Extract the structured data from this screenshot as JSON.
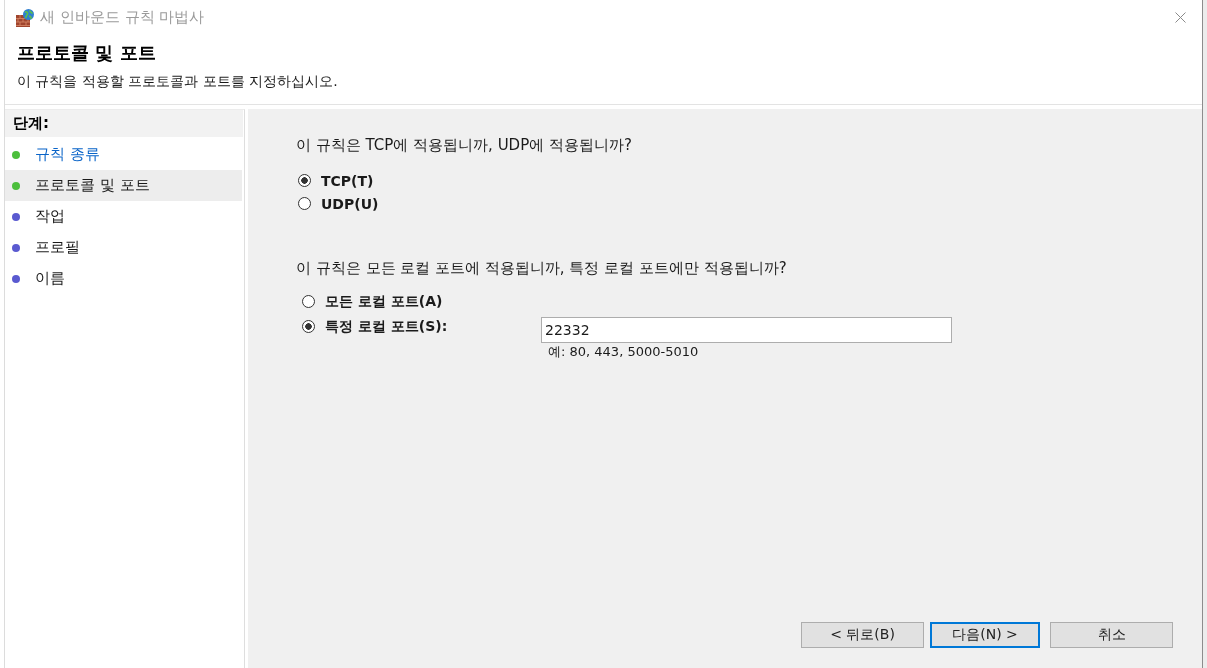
{
  "window": {
    "title": "새 인바운드 규칙 마법사"
  },
  "header": {
    "title": "프로토콜 및 포트",
    "description": "이 규칙을 적용할 프로토콜과 포트를 지정하십시오."
  },
  "steps": {
    "heading": "단계:",
    "items": [
      {
        "label": "규칙 종류",
        "selected": false,
        "link": true,
        "color": "#4cbf3c"
      },
      {
        "label": "프로토콜 및 포트",
        "selected": true,
        "link": false,
        "color": "#4cbf3c"
      },
      {
        "label": "작업",
        "selected": false,
        "link": false,
        "color": "#5a5ad0"
      },
      {
        "label": "프로필",
        "selected": false,
        "link": false,
        "color": "#5a5ad0"
      },
      {
        "label": "이름",
        "selected": false,
        "link": false,
        "color": "#5a5ad0"
      }
    ]
  },
  "protocol": {
    "question": "이 규칙은 TCP에 적용됩니까, UDP에 적용됩니까?",
    "options": [
      {
        "label": "TCP(T)",
        "selected": true
      },
      {
        "label": "UDP(U)",
        "selected": false
      }
    ]
  },
  "ports": {
    "question": "이 규칙은 모든 로컬 포트에 적용됩니까, 특정 로컬 포트에만 적용됩니까?",
    "options": [
      {
        "label": "모든 로컬 포트(A)",
        "selected": false
      },
      {
        "label": "특정 로컬 포트(S):",
        "selected": true
      }
    ],
    "field": {
      "value": "22332",
      "hint": "예: 80, 443, 5000-5010"
    }
  },
  "buttons": [
    {
      "label": "< 뒤로(B)",
      "focused": false
    },
    {
      "label": "다음(N) >",
      "focused": true
    },
    {
      "label": "취소",
      "focused": false
    }
  ]
}
